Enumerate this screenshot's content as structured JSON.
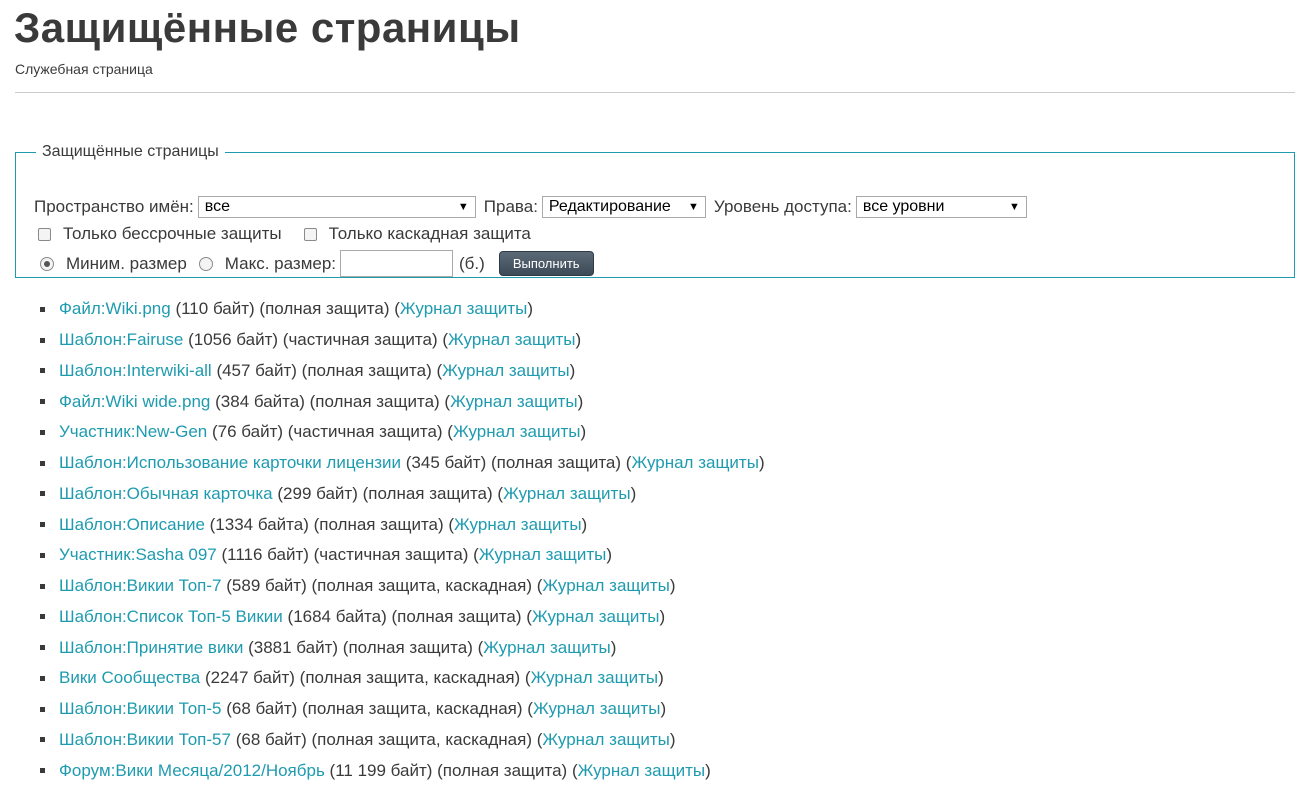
{
  "header": {
    "title": "Защищённые страницы",
    "subtitle": "Служебная страница"
  },
  "filters": {
    "legend": "Защищённые страницы",
    "namespace_label": "Пространство имён:",
    "namespace_value": "все",
    "rights_label": "Права:",
    "rights_value": "Редактирование",
    "level_label": "Уровень доступа:",
    "level_value": "все уровни",
    "indefinite_label": "Только бессрочные защиты",
    "cascade_label": "Только каскадная защита",
    "min_size_label": "Миним. размер",
    "max_size_label": "Макс. размер:",
    "size_unit": "(б.)",
    "submit_label": "Выполнить"
  },
  "pages": [
    {
      "title": "Файл:Wiki.png",
      "info": "(110 байт) (полная защита) (",
      "log": "Журнал защиты",
      "close": ")"
    },
    {
      "title": "Шаблон:Fairuse",
      "info": "(1056 байт) (частичная защита) (",
      "log": "Журнал защиты",
      "close": ")"
    },
    {
      "title": "Шаблон:Interwiki-all",
      "info": "(457 байт) (полная защита) (",
      "log": "Журнал защиты",
      "close": ")"
    },
    {
      "title": "Файл:Wiki wide.png",
      "info": "(384 байта) (полная защита) (",
      "log": "Журнал защиты",
      "close": ")"
    },
    {
      "title": "Участник:New-Gen",
      "info": "(76 байт) (частичная защита) (",
      "log": "Журнал защиты",
      "close": ")"
    },
    {
      "title": "Шаблон:Использование карточки лицензии",
      "info": "(345 байт) (полная защита) (",
      "log": "Журнал защиты",
      "close": ")"
    },
    {
      "title": "Шаблон:Обычная карточка",
      "info": "(299 байт) (полная защита) (",
      "log": "Журнал защиты",
      "close": ")"
    },
    {
      "title": "Шаблон:Описание",
      "info": "(1334 байта) (полная защита) (",
      "log": "Журнал защиты",
      "close": ")"
    },
    {
      "title": "Участник:Sasha 097",
      "info": "(1116 байт) (частичная защита) (",
      "log": "Журнал защиты",
      "close": ")"
    },
    {
      "title": "Шаблон:Викии Топ-7",
      "info": "(589 байт) (полная защита, каскадная) (",
      "log": "Журнал защиты",
      "close": ")"
    },
    {
      "title": "Шаблон:Список Топ-5 Викии",
      "info": "(1684 байта) (полная защита) (",
      "log": "Журнал защиты",
      "close": ")"
    },
    {
      "title": "Шаблон:Принятие вики",
      "info": "(3881 байт) (полная защита) (",
      "log": "Журнал защиты",
      "close": ")"
    },
    {
      "title": "Вики Сообщества",
      "info": "(2247 байт) (полная защита, каскадная) (",
      "log": "Журнал защиты",
      "close": ")"
    },
    {
      "title": "Шаблон:Викии Топ-5",
      "info": "(68 байт) (полная защита, каскадная) (",
      "log": "Журнал защиты",
      "close": ")"
    },
    {
      "title": "Шаблон:Викии Топ-57",
      "info": "(68 байт) (полная защита, каскадная) (",
      "log": "Журнал защиты",
      "close": ")"
    },
    {
      "title": "Форум:Вики Месяца/2012/Ноябрь",
      "info": "(11 199 байт) (полная защита) (",
      "log": "Журнал защиты",
      "close": ")"
    }
  ]
}
